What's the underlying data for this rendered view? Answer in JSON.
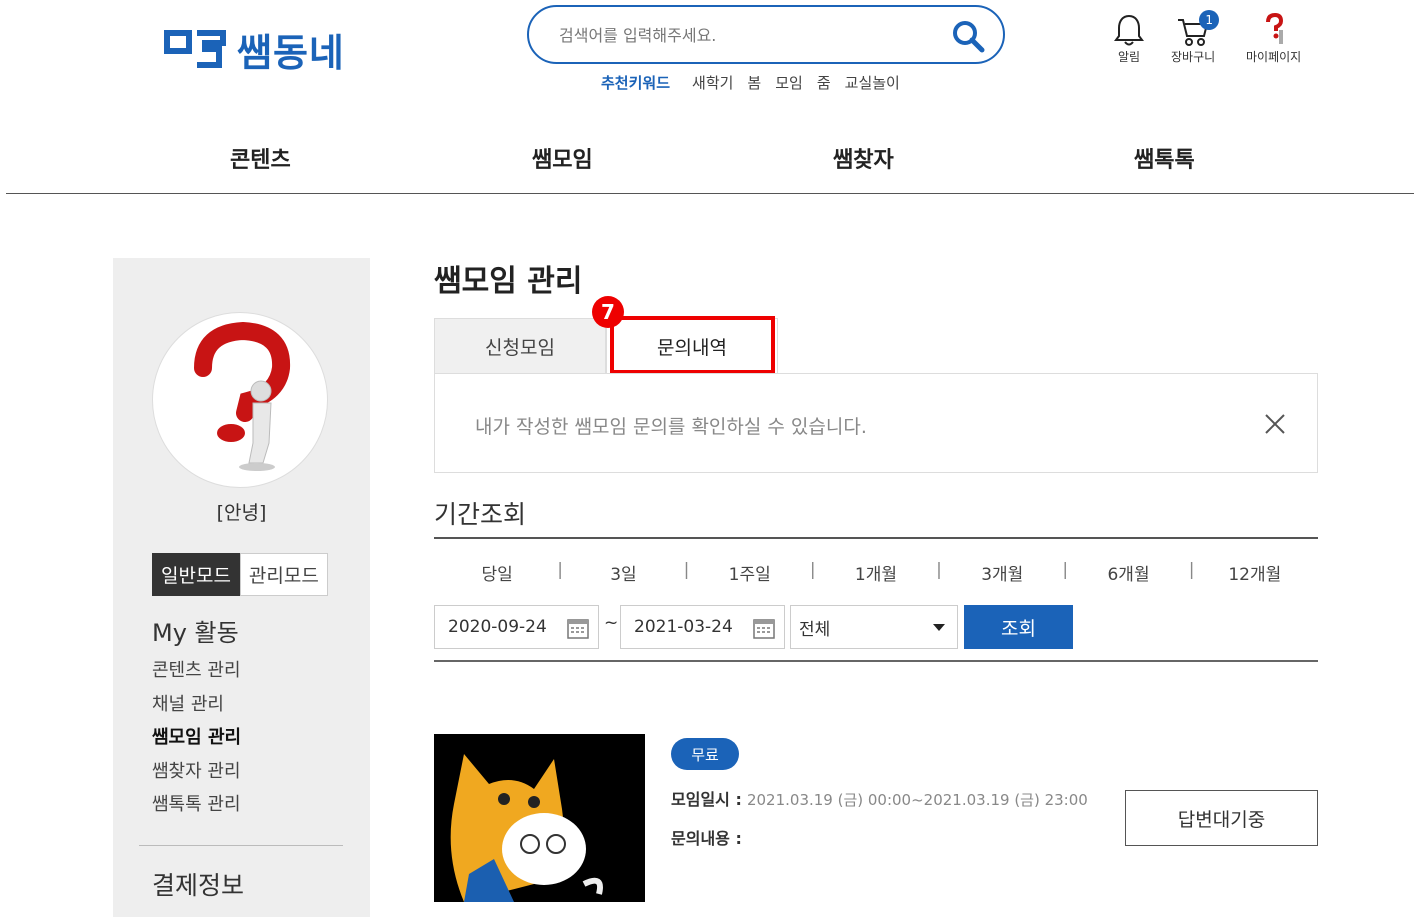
{
  "header": {
    "logo_text": "쌤동네",
    "search_placeholder": "검색어를 입력해주세요.",
    "keywords_label": "추천키워드",
    "keywords": [
      "새학기",
      "봄",
      "모임",
      "줌",
      "교실놀이"
    ],
    "icons": {
      "alarm_label": "알림",
      "cart_label": "장바구니",
      "cart_count": "1",
      "mypage_label": "마이페이지"
    }
  },
  "gnb": [
    "콘텐츠",
    "쌤모임",
    "쌤찾자",
    "쌤톡톡"
  ],
  "sidebar": {
    "nickname": "[안녕]",
    "mode_general": "일반모드",
    "mode_admin": "관리모드",
    "activity_title": "My 활동",
    "menu": [
      "콘텐츠 관리",
      "채널 관리",
      "쌤모임 관리",
      "쌤찾자 관리",
      "쌤톡톡 관리"
    ],
    "payment_title": "결제정보"
  },
  "main": {
    "title": "쌤모임 관리",
    "tabs": [
      "신청모임",
      "문의내역"
    ],
    "marker": "7",
    "notice": "내가 작성한 쌤모임 문의를 확인하실 수 있습니다.",
    "period_title": "기간조회",
    "periods": [
      "당일",
      "3일",
      "1주일",
      "1개월",
      "3개월",
      "6개월",
      "12개월"
    ],
    "date_from": "2020-09-24",
    "date_sep": "~",
    "date_to": "2021-03-24",
    "select_value": "전체",
    "search_label": "조회"
  },
  "item": {
    "badge": "무료",
    "datetime_label": "모임일시 :",
    "datetime_value": "2021.03.19 (금) 00:00~2021.03.19 (금) 23:00",
    "inquiry_label": "문의내용 :",
    "status": "답변대기중"
  },
  "colors": {
    "brand": "#1b63b8",
    "highlight": "#ee0000"
  }
}
